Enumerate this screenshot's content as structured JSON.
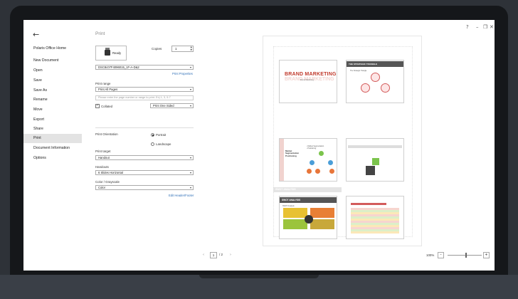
{
  "window": {
    "controls": [
      "?",
      "–",
      "❐",
      "✕"
    ]
  },
  "sidebar": {
    "back_glyph": "←",
    "items": [
      {
        "label": "Polaris Office Home"
      },
      {
        "label": "New Document"
      },
      {
        "label": "Open"
      },
      {
        "label": "Save"
      },
      {
        "label": "Save As"
      },
      {
        "label": "Rename"
      },
      {
        "label": "Move"
      },
      {
        "label": "Export"
      },
      {
        "label": "Share"
      },
      {
        "label": "Print",
        "active": true
      },
      {
        "label": "Document Information"
      },
      {
        "label": "Options"
      }
    ]
  },
  "print": {
    "title": "Print",
    "printer_name": "Ready",
    "copies_label": "Copies",
    "copies_value": "1",
    "printer_select": "DSC8c07F4096015_1F-A-D&2",
    "printer_properties": "Print Properties",
    "range_label": "Print range",
    "range_value": "Print All Pages",
    "range_placeholder": "Please enter the page number or range to print. Ex) 1, 3, 5-7",
    "collated_label": "Collated",
    "collated_mark": "✓",
    "sides_value": "Print One Sided",
    "orientation_label": "Print Orientation",
    "portrait_label": "Portrait",
    "landscape_label": "Landscape",
    "target_label": "Print target",
    "target_value": "Handout",
    "handouts_label": "Handouts",
    "handouts_value": "6 Slides Horizontal",
    "color_label": "Color / Grayscale",
    "color_value": "Color",
    "header_footer_link": "Edit Header/Footer"
  },
  "preview": {
    "slide1_title": "BRAND MARKETING",
    "slide1_subtitle": "Brand Marketing",
    "slide2_title": "THE STRATEGIC TRIANGLE",
    "slide2_sub": "The Strategic Triangle",
    "slide3_title": "Market Segmentation Positioning",
    "slide3_list": "• Market Segmentation\n• Positioning",
    "slide4_title": "SWOT ANALYSIS",
    "slide5_title": "SWOT ANALYSIS",
    "slide5_sub": "SWOT Analysis"
  },
  "pager": {
    "prev": "‹",
    "current": "1",
    "separator_total": "/ 2",
    "next": "›"
  },
  "zoom": {
    "label": "100%",
    "minus": "–",
    "plus": "+",
    "level": 0.55
  },
  "colors": {
    "accent": "#2f6fb7",
    "active_bg": "#e3e3e3",
    "brand_red": "#c0392b"
  }
}
